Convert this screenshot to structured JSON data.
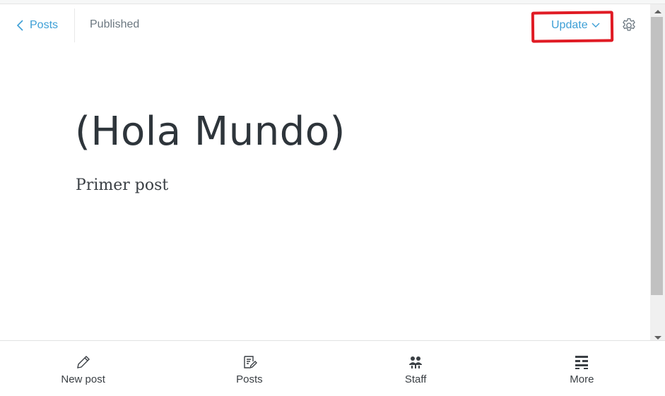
{
  "toolbar": {
    "back_label": "Posts",
    "status": "Published",
    "update_label": "Update"
  },
  "post": {
    "title": "(Hola Mundo)",
    "body": "Primer post"
  },
  "bottom_nav": {
    "items": [
      {
        "label": "New post",
        "icon": "pencil-icon"
      },
      {
        "label": "Posts",
        "icon": "posts-icon"
      },
      {
        "label": "Staff",
        "icon": "staff-icon"
      },
      {
        "label": "More",
        "icon": "more-icon"
      }
    ]
  },
  "colors": {
    "accent": "#3d9fd6",
    "annotation": "#e01b24",
    "title": "#2e353b"
  }
}
